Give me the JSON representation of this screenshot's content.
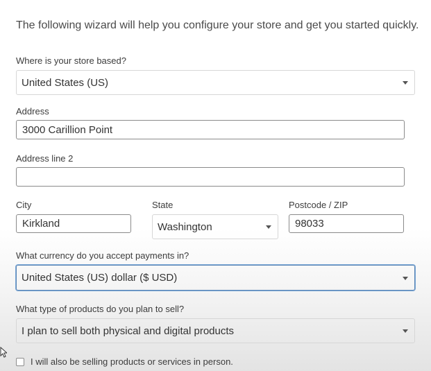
{
  "intro_text": "The following wizard will help you configure your store and get you started quickly.",
  "store_location": {
    "label": "Where is your store based?",
    "value": "United States (US)"
  },
  "address": {
    "label": "Address",
    "value": "3000 Carillion Point"
  },
  "address2": {
    "label": "Address line 2",
    "value": ""
  },
  "city": {
    "label": "City",
    "value": "Kirkland"
  },
  "state": {
    "label": "State",
    "value": "Washington"
  },
  "postcode": {
    "label": "Postcode / ZIP",
    "value": "98033"
  },
  "currency": {
    "label": "What currency do you accept payments in?",
    "value": "United States (US) dollar ($ USD)"
  },
  "product_type": {
    "label": "What type of products do you plan to sell?",
    "value": "I plan to sell both physical and digital products"
  },
  "in_person": {
    "label": "I will also be selling products or services in person.",
    "checked": false
  },
  "icons": {
    "caret": "chevron-down-icon",
    "cursor": "mouse-pointer-icon"
  },
  "colors": {
    "focus_border": "#5b86b5",
    "border": "#d6d6d6",
    "input_border": "#8a8a8a"
  }
}
